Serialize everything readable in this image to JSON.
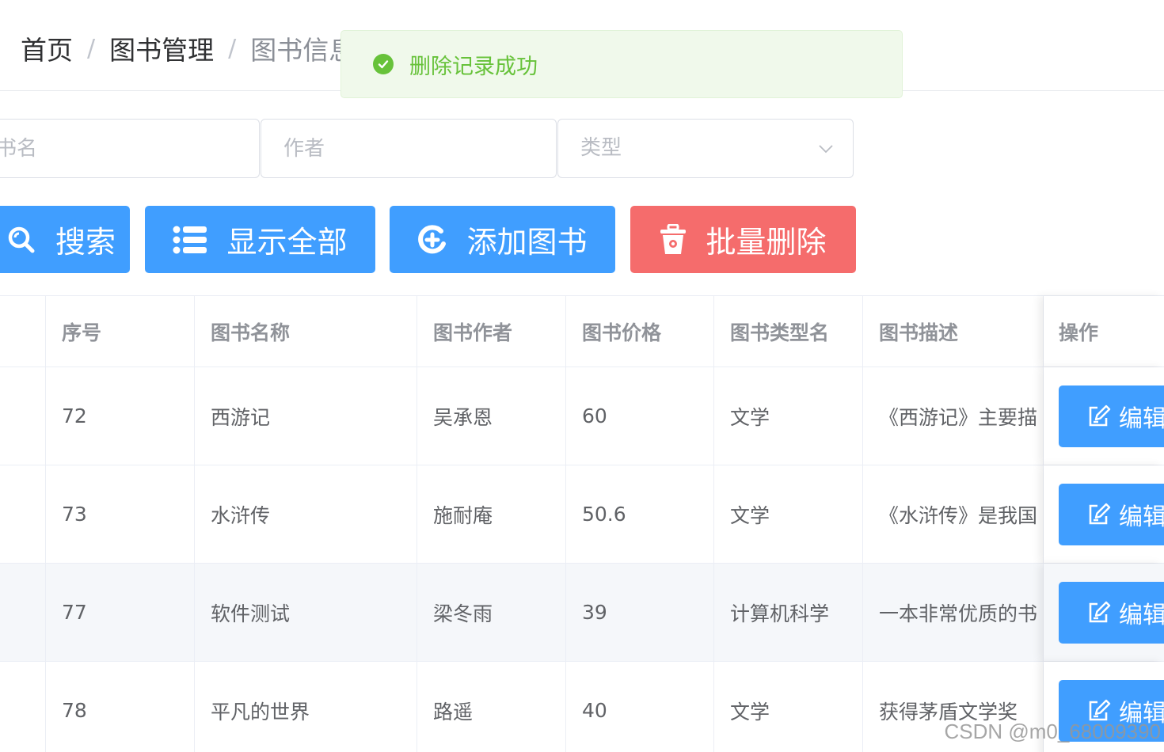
{
  "breadcrumb": {
    "items": [
      "首页",
      "图书管理",
      "图书信息"
    ],
    "separator": "/"
  },
  "toast": {
    "message": "删除记录成功",
    "type": "success"
  },
  "search": {
    "book_placeholder": "书名",
    "author_placeholder": "作者",
    "type_placeholder": "类型"
  },
  "toolbar": {
    "search_label": "搜索",
    "show_all_label": "显示全部",
    "add_label": "添加图书",
    "batch_delete_label": "批量删除"
  },
  "table": {
    "headers": [
      "",
      "序号",
      "图书名称",
      "图书作者",
      "图书价格",
      "图书类型名",
      "图书描述",
      "操作"
    ],
    "rows": [
      {
        "id": "72",
        "name": "西游记",
        "author": "吴承恩",
        "price": "60",
        "type": "文学",
        "desc": "《西游记》主要描",
        "edit": "编辑"
      },
      {
        "id": "73",
        "name": "水浒传",
        "author": "施耐庵",
        "price": "50.6",
        "type": "文学",
        "desc": "《水浒传》是我国",
        "edit": "编辑"
      },
      {
        "id": "77",
        "name": "软件测试",
        "author": "梁冬雨",
        "price": "39",
        "type": "计算机科学",
        "desc": "一本非常优质的书",
        "edit": "编辑"
      },
      {
        "id": "78",
        "name": "平凡的世界",
        "author": "路遥",
        "price": "40",
        "type": "文学",
        "desc": "获得茅盾文学奖",
        "edit": "编辑"
      }
    ]
  },
  "watermark": "CSDN @m0_68009390",
  "colors": {
    "primary": "#409eff",
    "danger": "#f56c6c",
    "success": "#67c23a",
    "success_bg": "#f0f9eb"
  }
}
